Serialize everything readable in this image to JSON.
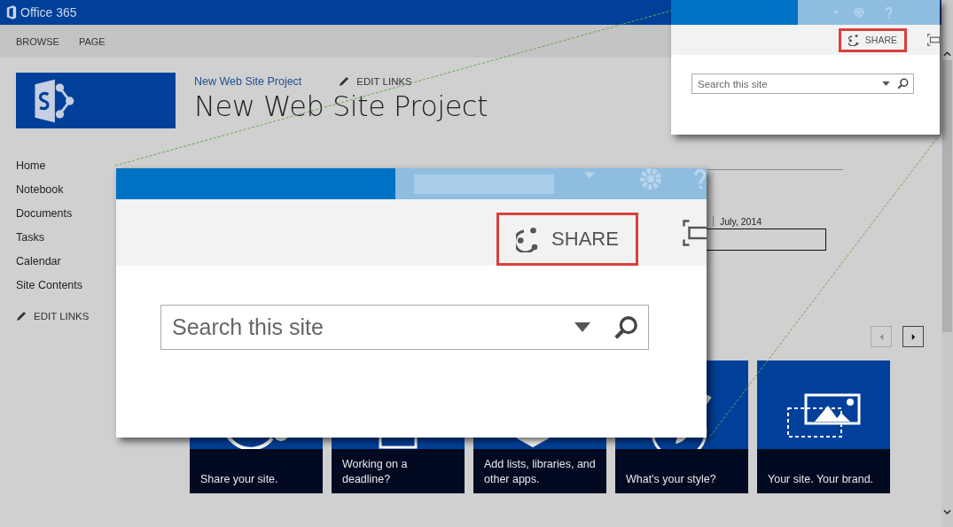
{
  "top_bar": {
    "brand": "Office 365"
  },
  "ribbon_tabs": [
    {
      "label": "BROWSE"
    },
    {
      "label": "PAGE"
    }
  ],
  "site": {
    "breadcrumb": "New Web Site Project",
    "edit_links": "EDIT LINKS",
    "title": "New Web Site Project"
  },
  "nav": {
    "items": [
      "Home",
      "Notebook",
      "Documents",
      "Tasks",
      "Calendar",
      "Site Contents"
    ],
    "edit_links": "EDIT LINKS"
  },
  "timeline": {
    "date": "July, 2014"
  },
  "tiles": [
    {
      "kind": "share",
      "caption": "Share your site."
    },
    {
      "kind": "deadline",
      "caption": "Working on a deadline?"
    },
    {
      "kind": "apps",
      "caption": "Add lists, libraries, and other apps."
    },
    {
      "kind": "style",
      "caption": "What's your style?"
    },
    {
      "kind": "brand",
      "caption": "Your site. Your brand."
    }
  ],
  "callouts": [
    {
      "share_label": "SHARE",
      "search_placeholder": "Search this site"
    },
    {
      "share_label": "SHARE",
      "search_placeholder": "Search this site"
    }
  ]
}
